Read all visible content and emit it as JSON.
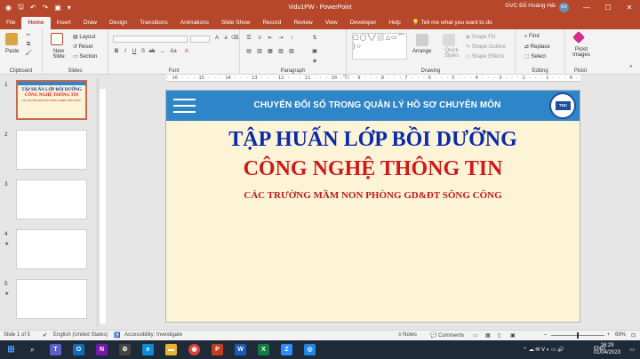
{
  "titlebar": {
    "document_title": "Vidu1PW  -  PowerPoint",
    "user_name": "GVC Đỗ Hoàng Hải",
    "avatar_initials": "GV",
    "quick_access": [
      "save-icon",
      "undo-icon",
      "redo-icon",
      "start-slideshow-icon"
    ],
    "window_controls": [
      "—",
      "☐",
      "✕"
    ]
  },
  "tabs": {
    "items": [
      "File",
      "Home",
      "Insert",
      "Draw",
      "Design",
      "Transitions",
      "Animations",
      "Slide Show",
      "Record",
      "Review",
      "View",
      "Developer",
      "Help"
    ],
    "active": "Home",
    "tell_me": "Tell me what you want to do"
  },
  "ribbon": {
    "clipboard": {
      "paste": "Paste",
      "label": "Clipboard"
    },
    "slides": {
      "new_slide": "New Slide",
      "layout": "Layout",
      "reset": "Reset",
      "section": "Section",
      "label": "Slides"
    },
    "font": {
      "label": "Font"
    },
    "paragraph": {
      "label": "Paragraph"
    },
    "drawing": {
      "arrange": "Arrange",
      "quick_styles": "Quick Styles",
      "shape_fill": "Shape Fill",
      "shape_outline": "Shape Outline",
      "shape_effects": "Shape Effects",
      "label": "Drawing"
    },
    "editing": {
      "find": "Find",
      "replace": "Replace",
      "select": "Select",
      "label": "Editing"
    },
    "pickit": {
      "btn": "Pickit Images",
      "label": "Pickit"
    }
  },
  "thumbnails": {
    "numbers": [
      "1",
      "2",
      "3",
      "4",
      "5"
    ],
    "slide1_line1": "TẬP HUẤN LỚP BỒI DƯỠNG",
    "slide1_line2": "CÔNG NGHỆ THÔNG TIN",
    "slide1_line3": "CÁC TRƯỜNG MẦM NON PHÒNG GD&ĐT SÔNG CÔNG",
    "starred": [
      "4",
      "5"
    ]
  },
  "ruler": {
    "horizontal": "· 16 · · · 15 · · · 14 · · · 13 · · · 12 · · · 11 · · · 10 · · · 9 · · · 8 · · · 7 · · · 6 · · · 5 · · · 4 · · · 3 · · · 2 · · · 1 · · · 0 · · · 1 · · · 2 · · · 3 · · · 4 · · · 5 · · · 6 · · · 7 · · · 8 · · · 9 · · · 10 · · · 11 · · · 12 · · · 13 · · · 14 · · · 15 · · · 16 ·"
  },
  "slide": {
    "banner_text": "CHUYỂN ĐỔI SỐ TRONG QUẢN LÝ HỒ SƠ CHUYÊN MÔN",
    "logo_text": "TNC",
    "title_line1": "TẬP HUẤN LỚP BỒI DƯỠNG",
    "title_line2": "CÔNG NGHỆ THÔNG TIN",
    "subtitle": "CÁC TRƯỜNG MẦM NON PHÒNG GD&ĐT SÔNG CÔNG",
    "colors": {
      "banner": "#2e86c9",
      "background": "#fdf4d8",
      "title_blue": "#0b2aa8",
      "title_red": "#d01818"
    }
  },
  "status": {
    "slide_of": "Slide 1 of 5",
    "language": "English (United States)",
    "accessibility": "Accessibility: Investigate",
    "notes": "Notes",
    "comments": "Comments",
    "zoom": "69%",
    "zoom_fraction": 0.5
  },
  "taskbar": {
    "language": "ENG",
    "time": "16:29",
    "date": "01/04/2023"
  },
  "accent": "#b7472a"
}
